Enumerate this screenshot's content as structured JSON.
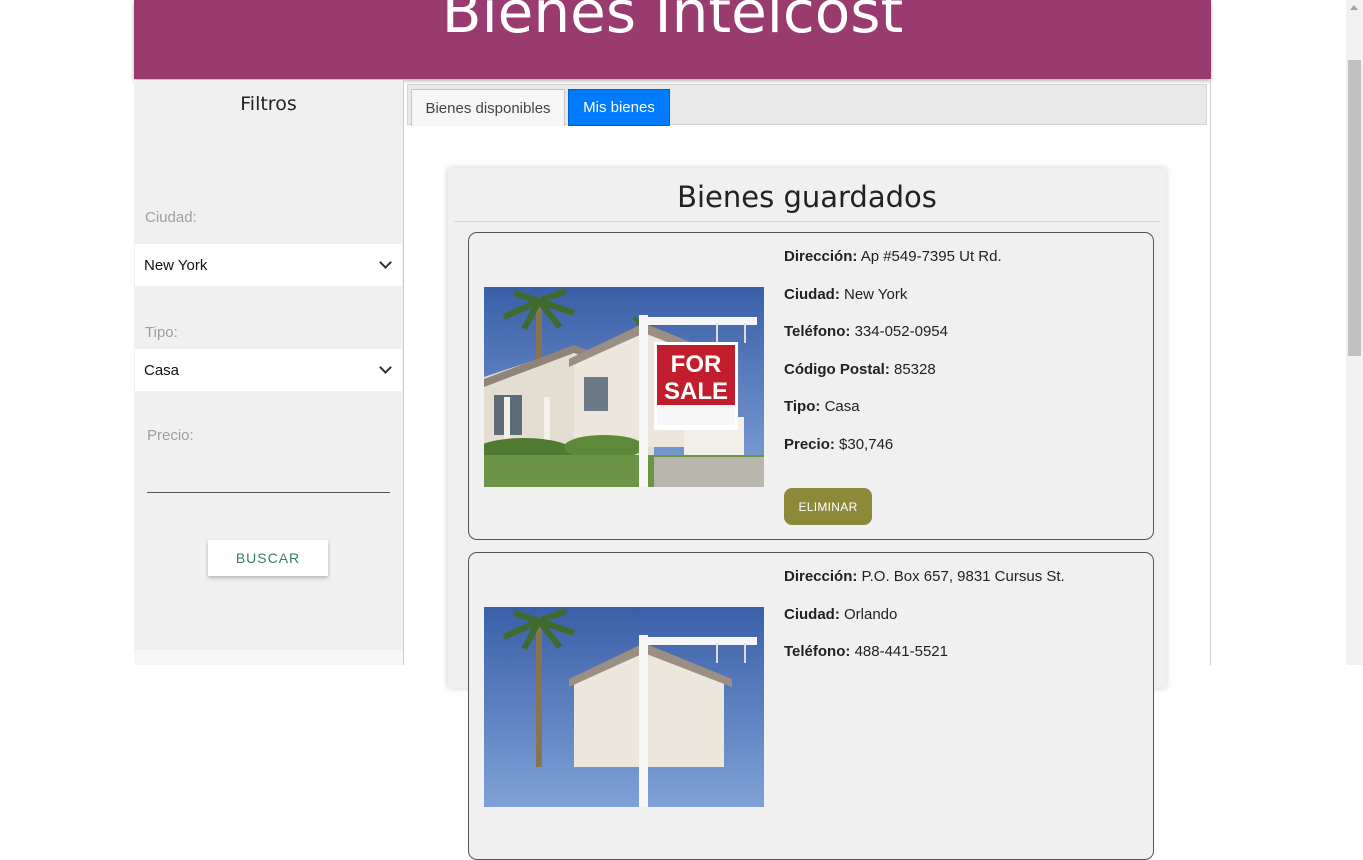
{
  "header": {
    "title": "Bienes Intelcost"
  },
  "sidebar": {
    "title": "Filtros",
    "ciudad_label": "Ciudad:",
    "ciudad_value": "New York",
    "tipo_label": "Tipo:",
    "tipo_value": "Casa",
    "precio_label": "Precio:",
    "buscar_label": "BUSCAR"
  },
  "tabs": [
    {
      "label": "Bienes disponibles",
      "active": false
    },
    {
      "label": "Mis bienes",
      "active": true
    }
  ],
  "panel": {
    "title": "Bienes guardados"
  },
  "labels": {
    "direccion": "Dirección:",
    "ciudad": "Ciudad:",
    "telefono": "Teléfono:",
    "codigo_postal": "Código Postal:",
    "tipo": "Tipo:",
    "precio": "Precio:"
  },
  "properties": [
    {
      "direccion": "Ap #549-7395 Ut Rd.",
      "ciudad": "New York",
      "telefono": "334-052-0954",
      "codigo_postal": "85328",
      "tipo": "Casa",
      "precio": "$30,746",
      "delete_label": "ELIMINAR",
      "sign_text": [
        "FOR",
        "SALE"
      ]
    },
    {
      "direccion": "P.O. Box 657, 9831 Cursus St.",
      "ciudad": "Orlando",
      "telefono": "488-441-5521"
    }
  ],
  "colors": {
    "header": "#993b6f",
    "tab_active": "#007bff",
    "delete_button": "#8c8a38"
  }
}
